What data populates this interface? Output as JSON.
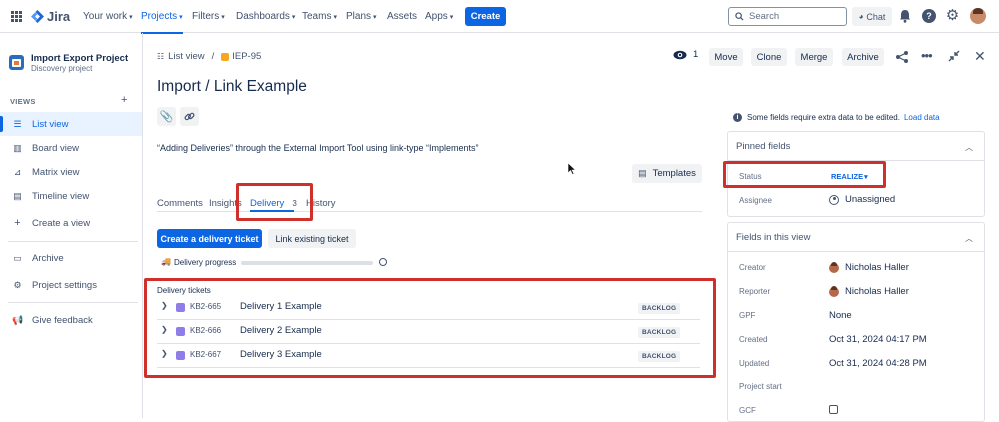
{
  "topbar": {
    "app_name": "Jira",
    "nav": [
      "Your work",
      "Projects",
      "Filters",
      "Dashboards",
      "Teams",
      "Plans",
      "Assets",
      "Apps"
    ],
    "create_label": "Create",
    "search_placeholder": "Search",
    "chat_label": "Chat"
  },
  "sidebar": {
    "project_name": "Import Export Project",
    "project_type": "Discovery project",
    "views_heading": "VIEWS",
    "items": [
      {
        "label": "List view",
        "icon": "list-icon"
      },
      {
        "label": "Board view",
        "icon": "board-icon"
      },
      {
        "label": "Matrix view",
        "icon": "matrix-icon"
      },
      {
        "label": "Timeline view",
        "icon": "timeline-icon"
      },
      {
        "label": "Create a view",
        "icon": "plus-icon"
      },
      {
        "label": "Archive",
        "icon": "archive-icon"
      },
      {
        "label": "Project settings",
        "icon": "settings-icon"
      },
      {
        "label": "Give feedback",
        "icon": "megaphone-icon"
      }
    ]
  },
  "header": {
    "breadcrumb_list": "List view",
    "breadcrumb_separator": "/",
    "breadcrumb_key": "IEP-95",
    "watch_count": "1",
    "actions": [
      "Move",
      "Clone",
      "Merge",
      "Archive"
    ]
  },
  "issue": {
    "title": "Import / Link Example",
    "description": "“Adding Deliveries” through the External Import Tool using link-type “Implements”",
    "templates_label": "Templates",
    "tabs": [
      {
        "label": "Comments"
      },
      {
        "label": "Insights"
      },
      {
        "label": "Delivery",
        "count": "3"
      },
      {
        "label": "History"
      }
    ],
    "create_delivery_label": "Create a delivery ticket",
    "link_existing_label": "Link existing ticket",
    "delivery_progress_label": "Delivery progress",
    "delivery_progress_fraction": 0,
    "tickets_heading": "Delivery tickets",
    "tickets": [
      {
        "key": "KB2-665",
        "summary": "Delivery 1 Example",
        "status": "BACKLOG"
      },
      {
        "key": "KB2-666",
        "summary": "Delivery 2 Example",
        "status": "BACKLOG"
      },
      {
        "key": "KB2-667",
        "summary": "Delivery 3 Example",
        "status": "BACKLOG"
      }
    ]
  },
  "right_panel": {
    "info_text": "Some fields require extra data to be edited.",
    "load_data_label": "Load data",
    "pinned_heading": "Pinned fields",
    "status_label": "Status",
    "status_value": "REALIZE",
    "assignee_label": "Assignee",
    "assignee_value": "Unassigned",
    "fields_heading": "Fields in this view",
    "fields": [
      {
        "label": "Creator",
        "value": "Nicholas Haller"
      },
      {
        "label": "Reporter",
        "value": "Nicholas Haller"
      },
      {
        "label": "GPF",
        "value": "None"
      },
      {
        "label": "Created",
        "value": "Oct 31, 2024 04:17 PM"
      },
      {
        "label": "Updated",
        "value": "Oct 31, 2024 04:28 PM"
      },
      {
        "label": "Project start",
        "value": ""
      },
      {
        "label": "GCF",
        "value": ""
      }
    ]
  },
  "colors": {
    "accent": "#0c66e4",
    "highlight_box": "#d0302c"
  }
}
